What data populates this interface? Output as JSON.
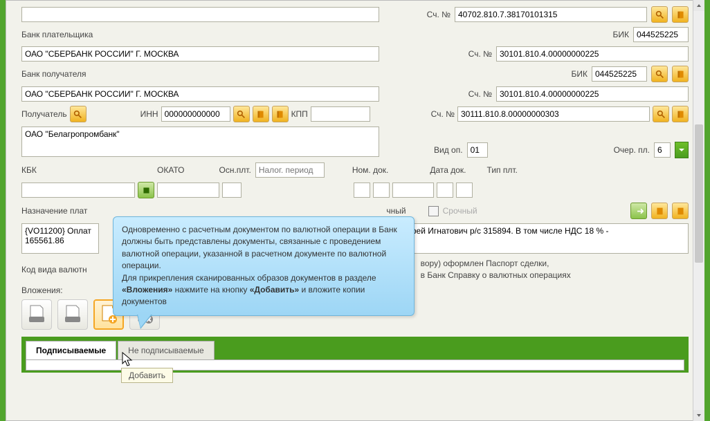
{
  "left": {
    "top_truncated": "",
    "payer_bank_label": "Банк плательщика",
    "payer_bank_value": "ОАО \"СБЕРБАНК РОССИИ\" Г. МОСКВА",
    "payee_bank_label": "Банк получателя",
    "payee_bank_value": "ОАО \"СБЕРБАНК РОССИИ\" Г. МОСКВА",
    "payee_label": "Получатель",
    "inn_label": "ИНН",
    "inn_value": "000000000000",
    "kpp_label": "КПП",
    "payee_name": "ОАО \"Белагропромбанк\"",
    "kbk_label": "КБК",
    "okato_label": "ОКАТО",
    "osn_label": "Осн.плт.",
    "tax_period_placeholder": "Налог. период",
    "nom_label": "Ном. док.",
    "date_label": "Дата док.",
    "type_label": "Тип плт."
  },
  "right": {
    "acc_label": "Сч. №",
    "bik_label": "БИК",
    "acc1": "40702.810.7.38170101315",
    "bik1": "044525225",
    "acc2": "30101.810.4.00000000225",
    "bik2": "044525225",
    "acc3": "30101.810.4.00000000225",
    "acc4": "30111.810.8.00000000303",
    "vid_op_label": "Вид оп.",
    "vid_op_value": "01",
    "ocher_label": "Очер. пл.",
    "ocher_value": "6"
  },
  "purpose": {
    "label": "Назначение плат",
    "option1": "чный",
    "option2": "Срочный",
    "text": "{VO11200} Оплат\n165561.86",
    "text_right": "офей Игнатович р/с 315894. В том числе НДС 18 % -"
  },
  "code_label": "Код вида валютн",
  "code_right1": "вору) оформлен Паспорт сделки,",
  "code_right2": "в Банк Справку о валютных операциях",
  "attach_label": "Вложения:",
  "add_hint": "Добавить",
  "tabs": {
    "signed": "Подписываемые",
    "unsigned": "Не подписываемые"
  },
  "tooltip": {
    "line1": "Одновременно с расчетным документом по валютной операции в Банк должны быть представлены документы, связанные с проведением валютной операции, указанной в расчетном документе по валютной операции.",
    "line2a": "Для прикрепления сканированных образов документов в разделе ",
    "bold1": "«Вложения»",
    "line2b": " нажмите на кнопку ",
    "bold2": "«Добавить»",
    "line3": " и вложите копии документов"
  }
}
